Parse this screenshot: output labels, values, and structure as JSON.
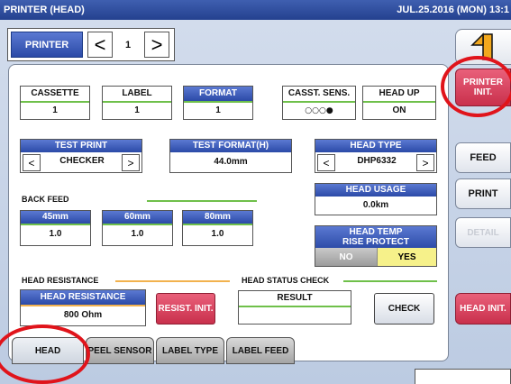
{
  "window": {
    "title": "PRINTER (HEAD)",
    "datetime": "JUL.25.2016 (MON) 13:1"
  },
  "nav": {
    "label": "PRINTER",
    "prev_glyph": "<",
    "value": "1",
    "next_glyph": ">"
  },
  "counters": {
    "cassette": {
      "label": "CASSETTE",
      "value": "1"
    },
    "label": {
      "label": "LABEL",
      "value": "1"
    },
    "format": {
      "label": "FORMAT",
      "value": "1"
    },
    "cassette_sens": {
      "label": "CASST. SENS.",
      "value": "○○○●"
    },
    "head_up": {
      "label": "HEAD UP",
      "value": "ON"
    }
  },
  "test_print": {
    "label": "TEST PRINT",
    "value": "CHECKER",
    "prev_glyph": "<",
    "next_glyph": ">"
  },
  "test_format": {
    "label": "TEST FORMAT(H)",
    "value": "44.0mm"
  },
  "head_type": {
    "label": "HEAD TYPE",
    "value": "DHP6332",
    "prev_glyph": "<",
    "next_glyph": ">"
  },
  "head_usage": {
    "label": "HEAD USAGE",
    "value": "0.0km"
  },
  "back_feed": {
    "title": "BACK FEED",
    "items": [
      {
        "label": "45mm",
        "value": "1.0"
      },
      {
        "label": "60mm",
        "value": "1.0"
      },
      {
        "label": "80mm",
        "value": "1.0"
      }
    ]
  },
  "head_temp": {
    "label_line1": "HEAD TEMP",
    "label_line2": "RISE PROTECT",
    "no": "NO",
    "yes": "YES",
    "selected": "YES"
  },
  "head_resistance": {
    "section": "HEAD RESISTANCE",
    "label": "HEAD RESISTANCE",
    "value": "800 Ohm",
    "reset_button": "RESIST. INIT."
  },
  "head_status": {
    "section": "HEAD STATUS CHECK",
    "result_label": "RESULT",
    "result_value": "",
    "check_button": "CHECK"
  },
  "tabs": [
    {
      "label": "HEAD",
      "active": true
    },
    {
      "label": "PEEL SENSOR",
      "active": false
    },
    {
      "label": "LABEL TYPE",
      "active": false
    },
    {
      "label": "LABEL FEED",
      "active": false
    }
  ],
  "right_panel": {
    "back_icon": "back-arrow-1-icon",
    "printer_init": {
      "line1": "PRINTER",
      "line2": "INIT."
    },
    "feed": "FEED",
    "print": "PRINT",
    "detail": "DETAIL",
    "head_init": "HEAD INIT."
  },
  "colors": {
    "accent_blue": "#2b4aa7",
    "alert_red": "#c9304c",
    "highlight_yellow": "#f6f18a",
    "annotation_red": "#e0141b"
  }
}
